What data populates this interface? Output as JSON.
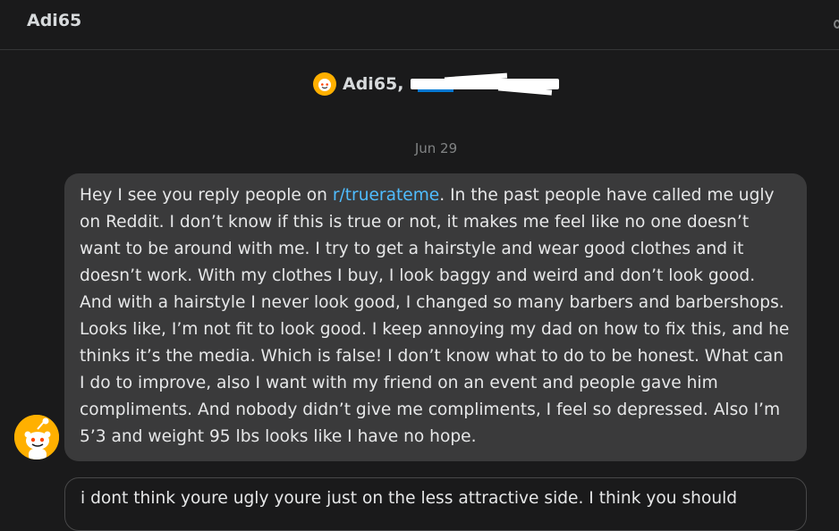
{
  "header": {
    "title": "Adi65"
  },
  "thread": {
    "participant_name": "Adi65,",
    "date_label": "Jun 29"
  },
  "messages": [
    {
      "parts": {
        "before_link": "Hey I see you reply people on ",
        "link": "r/truerateme",
        "after_link": ". In the past people have called me ugly on Reddit. I don’t know if this is true or not, it makes me feel like no one doesn’t want to be around with me. I try to get a hairstyle and wear good clothes and it doesn’t work. With my clothes I buy, I look baggy and weird and don’t look good. And with a hairstyle I never look good, I changed so many barbers and barbershops. Looks like, I’m not fit to look good. I keep annoying my dad on how to fix this, and he thinks it’s the media. Which is false! I don’t know what to do to be honest. What can I do to improve, also I want with my friend on an event and people gave him compliments. And nobody didn’t give me compliments, I feel so depressed. Also I’m 5’3 and weight 95 lbs looks like I have no hope."
      }
    },
    {
      "text": "i dont think youre ugly youre just on the less attractive side. I think you should"
    }
  ],
  "colors": {
    "background": "#1a1a1b",
    "bubble": "#3a3a3b",
    "link": "#4fbcff",
    "avatar": "#ffb000",
    "muted": "#818384"
  },
  "icons": {
    "user_avatar": "snoo-avatar-icon",
    "edge_icon": "partial-icon"
  }
}
